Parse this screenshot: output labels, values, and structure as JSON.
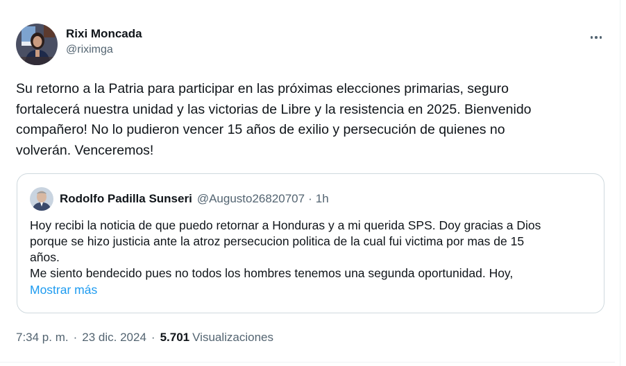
{
  "author": {
    "display_name": "Rixi Moncada",
    "handle": "@riximga"
  },
  "tweet": {
    "text": "Su retorno a la Patria para participar en las próximas elecciones primarias, seguro\nfortalecerá nuestra unidad y las victorias de Libre y la resistencia en 2025. Bienvenido\ncompañero! No lo pudieron vencer 15 años de exilio y persecución de quienes no\nvolverán. Venceremos!"
  },
  "quoted_tweet": {
    "display_name": "Rodolfo Padilla Sunseri",
    "handle": "@Augusto26820707",
    "separator": "·",
    "time": "1h",
    "text": "Hoy recibi la noticia de que puedo retornar a Honduras y a mi querida SPS. Doy gracias a Dios\nporque se hizo justicia ante la atroz persecucion politica de la cual fui victima por mas de 15\naños.\nMe siento bendecido pues no todos los hombres tenemos una segunda oportunidad. Hoy,",
    "show_more": "Mostrar más"
  },
  "meta": {
    "time": "7:34 p. m.",
    "separator": "·",
    "date": "23 dic. 2024",
    "views_count": "5.701",
    "views_label": "Visualizaciones"
  },
  "icons": {
    "more": "more-horizontal-icon"
  },
  "colors": {
    "link": "#1d9bf0",
    "secondary_text": "#536471",
    "primary_text": "#0f1419",
    "border": "#cfd9de"
  }
}
